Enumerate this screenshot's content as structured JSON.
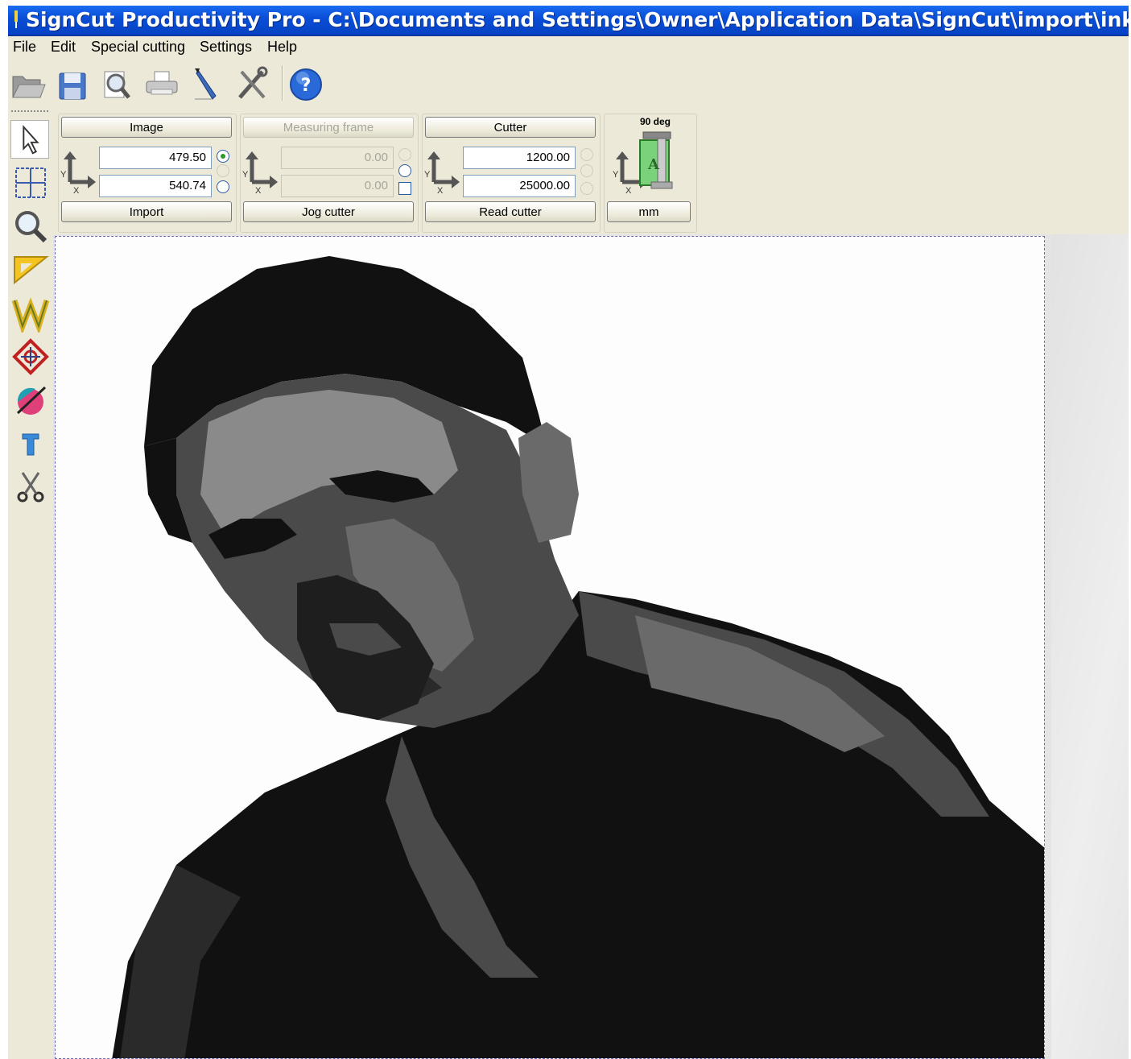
{
  "window": {
    "title": "SignCut Productivity Pro - C:\\Documents and Settings\\Owner\\Application Data\\SignCut\\import\\inkscape.eps"
  },
  "menu": [
    "File",
    "Edit",
    "Special cutting",
    "Settings",
    "Help"
  ],
  "toolbar": {
    "icons": [
      "open-icon",
      "save-icon",
      "print-preview-icon",
      "print-icon",
      "knife-icon",
      "tools-icon",
      "help-icon"
    ]
  },
  "tools": [
    "pointer-icon",
    "grid-icon",
    "zoom-icon",
    "ruler-icon",
    "weed-icon",
    "registration-mark-icon",
    "color-icon",
    "text-icon",
    "scissors-icon"
  ],
  "image_group": {
    "header": "Image",
    "x": "479.50",
    "y": "540.74",
    "action": "Import",
    "selected_radio": 0
  },
  "frame_group": {
    "header": "Measuring frame",
    "x": "0.00",
    "y": "0.00",
    "action": "Jog cutter"
  },
  "cutter_group": {
    "header": "Cutter",
    "x": "1200.00",
    "y": "25000.00",
    "action": "Read cutter"
  },
  "orientation_group": {
    "rotation": "90 deg",
    "unit": "mm"
  },
  "axis_labels": {
    "x": "X",
    "y": "Y"
  },
  "colors": {
    "titlebar": "#0a4fd8",
    "chrome": "#ece9d8",
    "photo_dark": "#111111",
    "photo_mid": "#4a4a4a",
    "photo_light": "#8a8a8a"
  }
}
